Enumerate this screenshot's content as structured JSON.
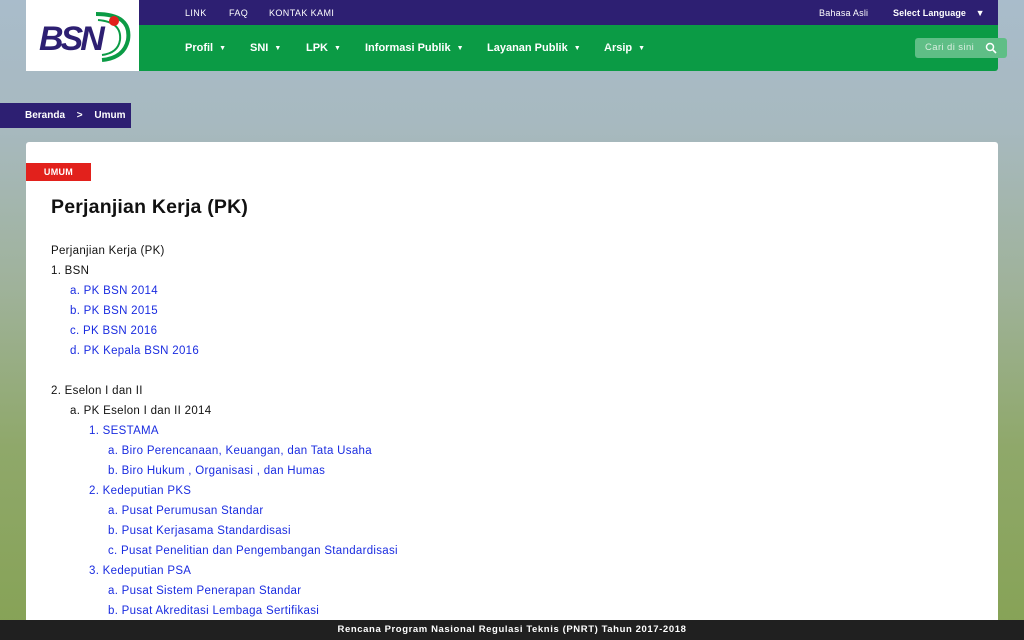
{
  "header": {
    "logo_text": "BSN",
    "toplinks": [
      "LINK",
      "FAQ",
      "KONTAK KAMI"
    ],
    "bahasa": "Bahasa Asli",
    "language_select": "Select Language",
    "nav": [
      "Profil",
      "SNI",
      "LPK",
      "Informasi Publik",
      "Layanan Publik",
      "Arsip"
    ],
    "search_placeholder": "Cari di sini",
    "colors": {
      "topbar": "#2d1f72",
      "navbar": "#0b9b45"
    }
  },
  "breadcrumb": {
    "home": "Beranda",
    "separator": ">",
    "current": "Umum"
  },
  "article": {
    "category": "UMUM",
    "title": "Perjanjian Kerja (PK)",
    "intro": "Perjanjian Kerja (PK)",
    "sections": {
      "bsn": {
        "heading": "1. BSN",
        "items": [
          "a. PK BSN 2014",
          "b. PK BSN 2015",
          "c. PK BSN 2016",
          "d. PK Kepala BSN 2016"
        ]
      },
      "eselon": {
        "heading": "2. Eselon I dan II",
        "sub_heading": "a. PK Eselon I dan II 2014",
        "units": [
          {
            "label": "1. SESTAMA",
            "items": [
              "a. Biro Perencanaan, Keuangan, dan Tata Usaha",
              "b. Biro Hukum , Organisasi , dan Humas"
            ]
          },
          {
            "label": "2. Kedeputian PKS",
            "items": [
              "a. Pusat Perumusan Standar",
              "b. Pusat Kerjasama Standardisasi",
              "c. Pusat Penelitian dan Pengembangan Standardisasi"
            ]
          },
          {
            "label": "3. Kedeputian PSA",
            "items": [
              "a. Pusat Sistem Penerapan Standar",
              "b. Pusat Akreditasi Lembaga Sertifikasi"
            ]
          }
        ]
      }
    }
  },
  "footer": {
    "ticker": "Rencana Program Nasional Regulasi Teknis (PNRT) Tahun 2017-2018"
  }
}
